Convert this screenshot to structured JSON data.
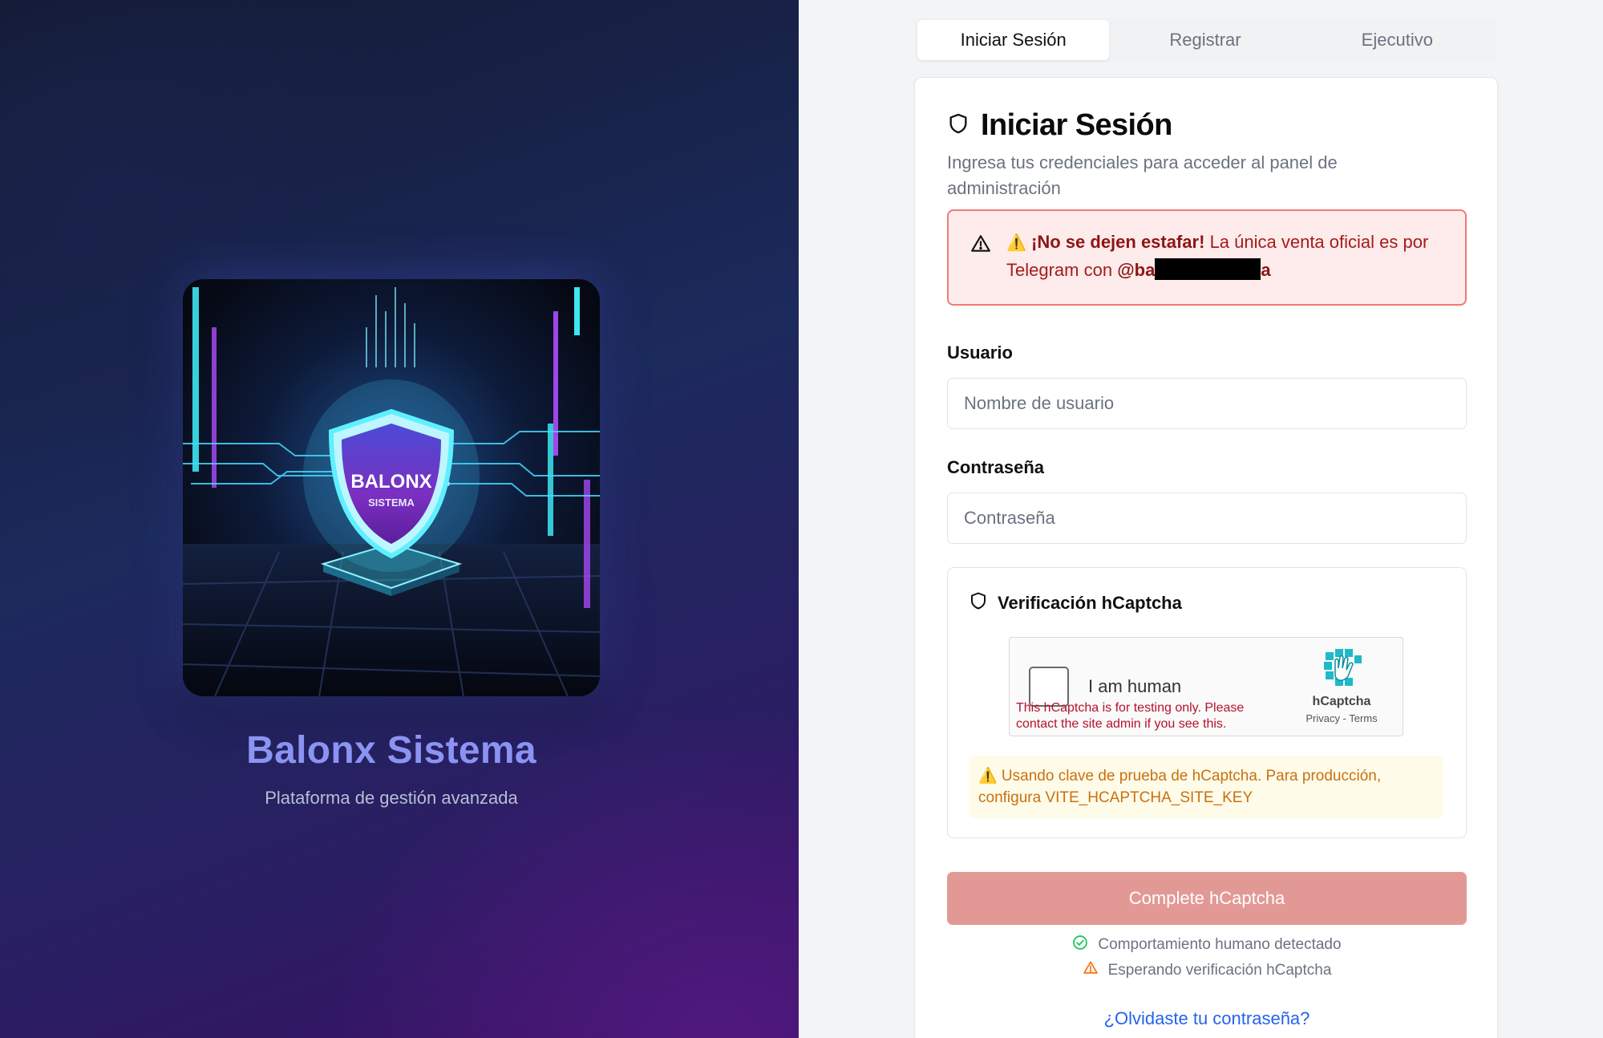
{
  "hero": {
    "title": "Balonx Sistema",
    "subtitle": "Plataforma de gestión avanzada",
    "image_text": "BALONX",
    "image_subtext": "SISTEMA",
    "image_icon": "shield-icon"
  },
  "tabs": [
    {
      "label": "Iniciar Sesión",
      "active": true
    },
    {
      "label": "Registrar",
      "active": false
    },
    {
      "label": "Ejecutivo",
      "active": false
    }
  ],
  "login": {
    "title": "Iniciar Sesión",
    "title_icon": "shield-icon",
    "description": "Ingresa tus credenciales para acceder al panel de administración",
    "alert": {
      "icon": "warning-triangle-icon",
      "emoji": "⚠️",
      "strong": "¡No se dejen estafar!",
      "text": "La única venta oficial es por Telegram con",
      "handle_start": "@ba",
      "handle_end": "a"
    },
    "username": {
      "label": "Usuario",
      "placeholder": "Nombre de usuario",
      "value": ""
    },
    "password": {
      "label": "Contraseña",
      "placeholder": "Contraseña",
      "value": ""
    },
    "captcha": {
      "heading": "Verificación hCaptcha",
      "heading_icon": "shield-icon",
      "widget_label": "I am human",
      "widget_warning": "This hCaptcha is for testing only. Please contact the site admin if you see this.",
      "brand": "hCaptcha",
      "links": "Privacy - Terms",
      "test_note": "⚠️ Usando clave de prueba de hCaptcha. Para producción, configura VITE_HCAPTCHA_SITE_KEY"
    },
    "submit_label": "Complete hCaptcha",
    "status": [
      {
        "text": "Comportamiento humano detectado",
        "icon": "check-circle-icon",
        "color": "#22c55e"
      },
      {
        "text": "Esperando verificación hCaptcha",
        "icon": "warning-triangle-icon",
        "color": "#f97316"
      }
    ],
    "forgot_label": "¿Olvidaste tu contraseña?"
  },
  "colors": {
    "accent_link": "#2563eb",
    "button_disabled": "#e29996",
    "alert_border": "#ef7a76",
    "hero_title": "#8b93f3"
  }
}
